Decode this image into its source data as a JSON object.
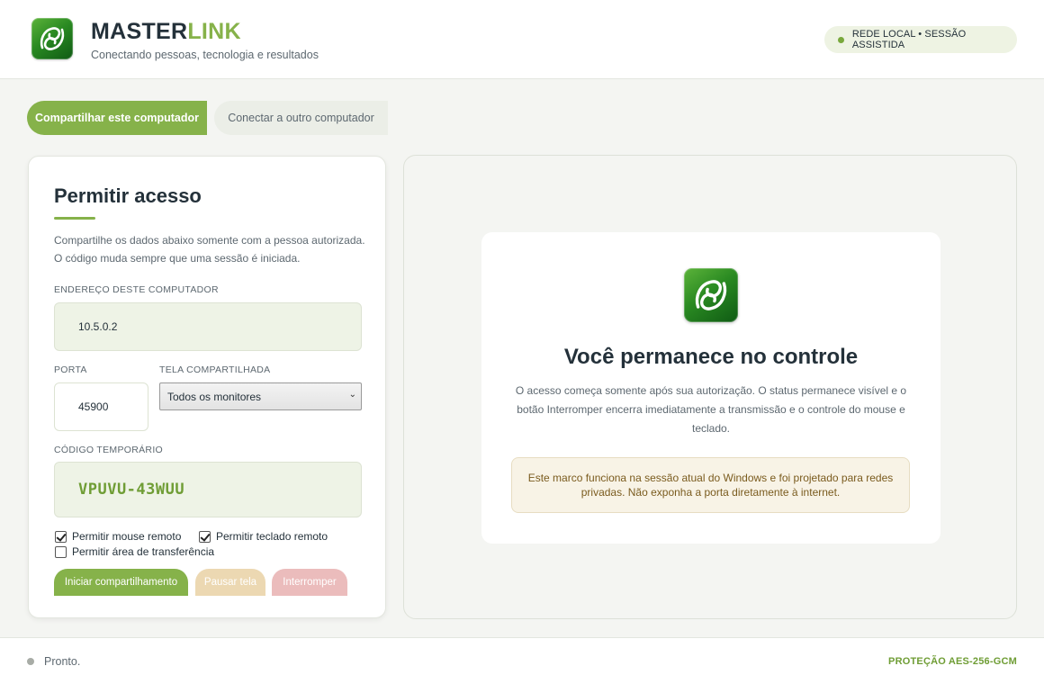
{
  "header": {
    "brand_part1": "MASTER",
    "brand_part2": "LINK",
    "tagline": "Conectando pessoas, tecnologia e resultados",
    "network_status": "REDE LOCAL • SESSÃO ASSISTIDA"
  },
  "tabs": {
    "share": "Compartilhar este computador",
    "connect": "Conectar a outro computador"
  },
  "access_card": {
    "title": "Permitir acesso",
    "description": "Compartilhe os dados abaixo somente com a pessoa autorizada. O código muda sempre que uma sessão é iniciada.",
    "address_label": "ENDEREÇO DESTE COMPUTADOR",
    "address_value": "10.5.0.2",
    "port_label": "PORTA",
    "port_value": "45900",
    "screen_label": "TELA COMPARTILHADA",
    "screen_value": "Todos os monitores",
    "code_label": "CÓDIGO TEMPORÁRIO",
    "code_value": "VPUVU-43WUU",
    "checkboxes": {
      "mouse": {
        "label": "Permitir mouse remoto",
        "checked": true
      },
      "keyboard": {
        "label": "Permitir teclado remoto",
        "checked": true
      },
      "clipboard": {
        "label": "Permitir área de transferência",
        "checked": false
      }
    },
    "buttons": {
      "start": "Iniciar compartilhamento",
      "pause": "Pausar tela",
      "stop": "Interromper"
    }
  },
  "control_panel": {
    "title": "Você permanece no controle",
    "description": "O acesso começa somente após sua autorização. O status permanece visível e o botão Interromper encerra imediatamente a transmissão e o controle do mouse e teclado.",
    "notice": "Este marco funciona na sessão atual do Windows e foi projetado para redes privadas. Não exponha a porta diretamente à internet."
  },
  "footer": {
    "status": "Pronto.",
    "protection": "PROTEÇÃO AES-256-GCM"
  },
  "colors": {
    "accent": "#86b24a",
    "dark": "#24313a",
    "pause": "#ecd8b2",
    "stop": "#ebbcbc"
  }
}
